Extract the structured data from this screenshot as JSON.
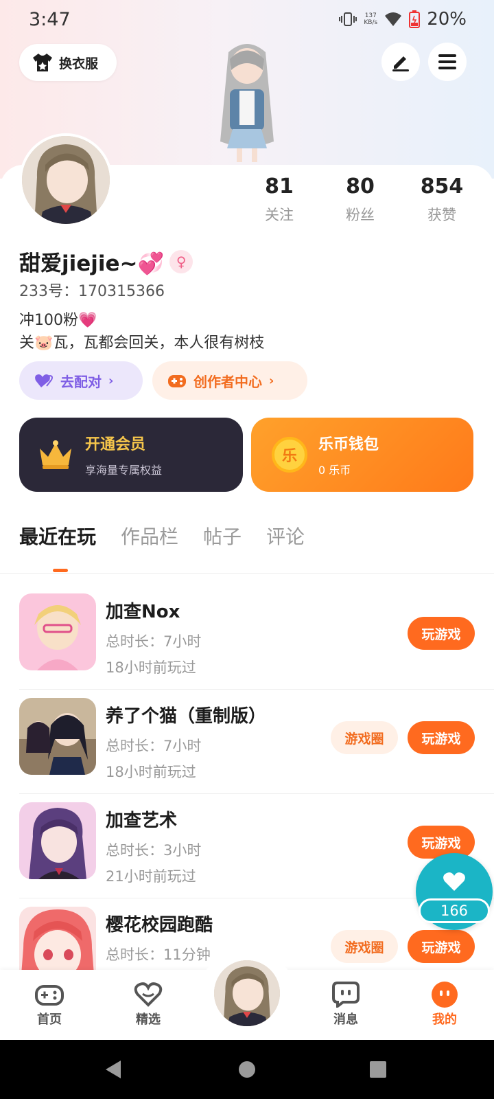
{
  "status": {
    "time": "3:47",
    "net_speed": "137\nKB/s",
    "battery": "20%"
  },
  "header": {
    "wardrobe_label": "换衣服"
  },
  "stats": [
    {
      "num": "81",
      "label": "关注"
    },
    {
      "num": "80",
      "label": "粉丝"
    },
    {
      "num": "854",
      "label": "获赞"
    }
  ],
  "profile": {
    "nickname": "甜爱jiejie~💞",
    "uid": "233号：170315366",
    "bio_line1": "冲100粉💗",
    "bio_line2": "关🐷瓦，瓦都会回关，本人很有树枝"
  },
  "actions": {
    "match_label": "去配对",
    "creator_label": "创作者中心"
  },
  "vip": {
    "title": "开通会员",
    "subtitle": "享海量专属权益"
  },
  "wallet": {
    "title": "乐币钱包",
    "subtitle": "0 乐币",
    "coin_char": "乐"
  },
  "tabs": [
    "最近在玩",
    "作品栏",
    "帖子",
    "评论"
  ],
  "games": [
    {
      "name": "加查Nox",
      "duration": "总时长：7小时",
      "last": "18小时前玩过",
      "play": "玩游戏",
      "circle": ""
    },
    {
      "name": "养了个猫（重制版）",
      "duration": "总时长：7小时",
      "last": "18小时前玩过",
      "play": "玩游戏",
      "circle": "游戏圈"
    },
    {
      "name": "加查艺术",
      "duration": "总时长：3小时",
      "last": "21小时前玩过",
      "play": "玩游戏",
      "circle": ""
    },
    {
      "name": "樱花校园跑酷",
      "duration": "总时长：11分钟",
      "last": "",
      "play": "玩游戏",
      "circle": "游戏圈"
    }
  ],
  "float": {
    "count": "166"
  },
  "nav": [
    {
      "label": "首页"
    },
    {
      "label": "精选"
    },
    {
      "label": "消息"
    },
    {
      "label": "我的"
    }
  ],
  "colors": {
    "accent": "#ff6a1f",
    "match": "#7f5ee5",
    "vip_bg": "#2b2838",
    "like": "#1bb5c6"
  }
}
